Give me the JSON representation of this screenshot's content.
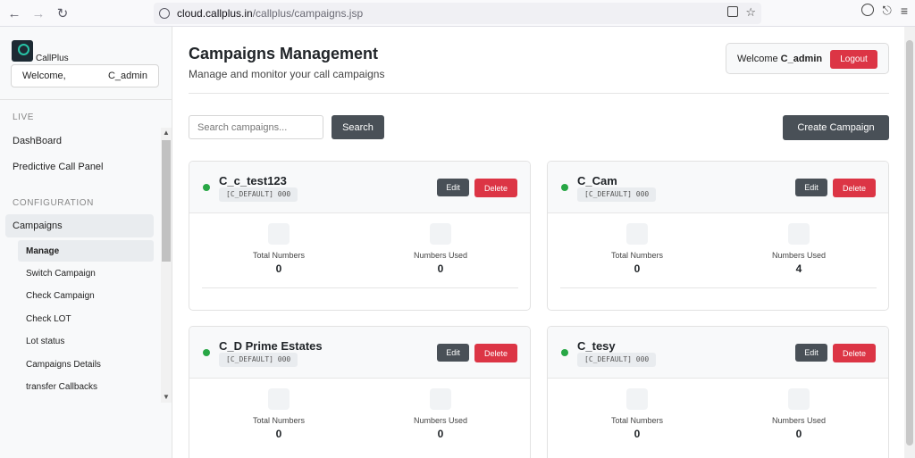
{
  "browser": {
    "url_domain": "cloud.callplus.in",
    "url_path": "/callplus/campaigns.jsp"
  },
  "sidebar": {
    "brand": "CallPlus",
    "welcome_label": "Welcome,",
    "welcome_user": "C_admin",
    "sections": [
      {
        "label": "LIVE",
        "items": [
          "DashBoard",
          "Predictive Call Panel"
        ]
      },
      {
        "label": "CONFIGURATION",
        "items": [
          "Campaigns"
        ]
      }
    ],
    "sub_items": [
      "Manage",
      "Switch Campaign",
      "Check Campaign",
      "Check LOT",
      "Lot status",
      "Campaigns Details",
      "transfer Callbacks"
    ]
  },
  "header": {
    "title": "Campaigns Management",
    "subtitle": "Manage and monitor your call campaigns",
    "welcome": "Welcome",
    "user": "C_admin",
    "logout": "Logout"
  },
  "toolbar": {
    "search_placeholder": "Search campaigns...",
    "search_button": "Search",
    "create_button": "Create Campaign"
  },
  "cards": [
    {
      "name": "C_c_test123",
      "tag": "[C_DEFAULT] 000",
      "edit": "Edit",
      "delete": "Delete",
      "total_label": "Total Numbers",
      "total": "0",
      "used_label": "Numbers Used",
      "used": "0",
      "status_color": "#28a745"
    },
    {
      "name": "C_Cam",
      "tag": "[C_DEFAULT] 000",
      "edit": "Edit",
      "delete": "Delete",
      "total_label": "Total Numbers",
      "total": "0",
      "used_label": "Numbers Used",
      "used": "4",
      "status_color": "#28a745"
    },
    {
      "name": "C_D Prime Estates",
      "tag": "[C_DEFAULT] 000",
      "edit": "Edit",
      "delete": "Delete",
      "total_label": "Total Numbers",
      "total": "0",
      "used_label": "Numbers Used",
      "used": "0",
      "status_color": "#28a745"
    },
    {
      "name": "C_tesy",
      "tag": "[C_DEFAULT] 000",
      "edit": "Edit",
      "delete": "Delete",
      "total_label": "Total Numbers",
      "total": "0",
      "used_label": "Numbers Used",
      "used": "0",
      "status_color": "#28a745"
    }
  ],
  "colors": {
    "primary_dark": "#495057",
    "danger": "#dc3545",
    "success": "#28a745"
  }
}
